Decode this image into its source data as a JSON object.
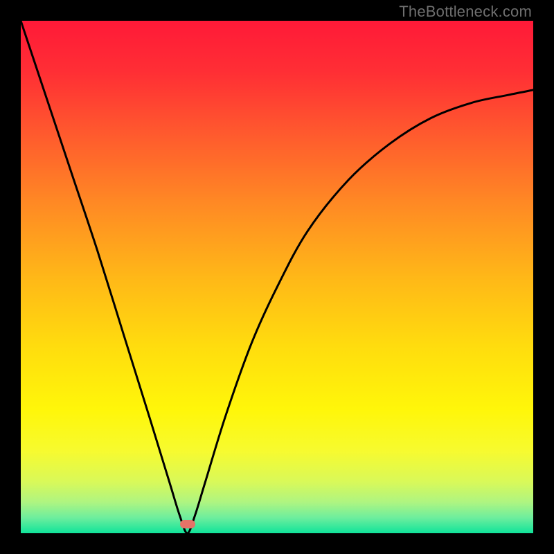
{
  "watermark": "TheBottleneck.com",
  "gradient": {
    "stops": [
      {
        "offset": 0.0,
        "color": "#ff1a38"
      },
      {
        "offset": 0.1,
        "color": "#ff2f35"
      },
      {
        "offset": 0.22,
        "color": "#ff5a2e"
      },
      {
        "offset": 0.36,
        "color": "#ff8b24"
      },
      {
        "offset": 0.5,
        "color": "#ffb818"
      },
      {
        "offset": 0.64,
        "color": "#ffde0e"
      },
      {
        "offset": 0.76,
        "color": "#fff70a"
      },
      {
        "offset": 0.84,
        "color": "#f7fb30"
      },
      {
        "offset": 0.9,
        "color": "#d9f95a"
      },
      {
        "offset": 0.94,
        "color": "#aef582"
      },
      {
        "offset": 0.97,
        "color": "#6dee9e"
      },
      {
        "offset": 1.0,
        "color": "#10e49a"
      }
    ]
  },
  "marker": {
    "x_frac": 0.325,
    "y_frac": 0.983,
    "color": "#e57368"
  },
  "chart_data": {
    "type": "line",
    "title": "",
    "xlabel": "",
    "ylabel": "",
    "xlim": [
      0,
      1
    ],
    "ylim": [
      0,
      1
    ],
    "note": "V-shaped bottleneck curve on a rainbow vertical gradient. x is normalized horizontal position inside the plot frame (0=left, 1=right); y is normalized penalty (0=bottom/green, 1=top/red). Minimum (optimal point) is at x≈0.325. Values estimated from pixels.",
    "series": [
      {
        "name": "bottleneck-curve",
        "x": [
          0.0,
          0.05,
          0.1,
          0.15,
          0.2,
          0.25,
          0.29,
          0.31,
          0.325,
          0.34,
          0.36,
          0.4,
          0.45,
          0.5,
          0.56,
          0.64,
          0.72,
          0.8,
          0.88,
          0.95,
          1.0
        ],
        "y": [
          1.0,
          0.85,
          0.7,
          0.55,
          0.39,
          0.23,
          0.1,
          0.035,
          0.0,
          0.035,
          0.1,
          0.23,
          0.37,
          0.48,
          0.59,
          0.69,
          0.76,
          0.81,
          0.84,
          0.855,
          0.865
        ]
      }
    ],
    "optimal_point": {
      "x": 0.325,
      "y": 0.0
    }
  }
}
